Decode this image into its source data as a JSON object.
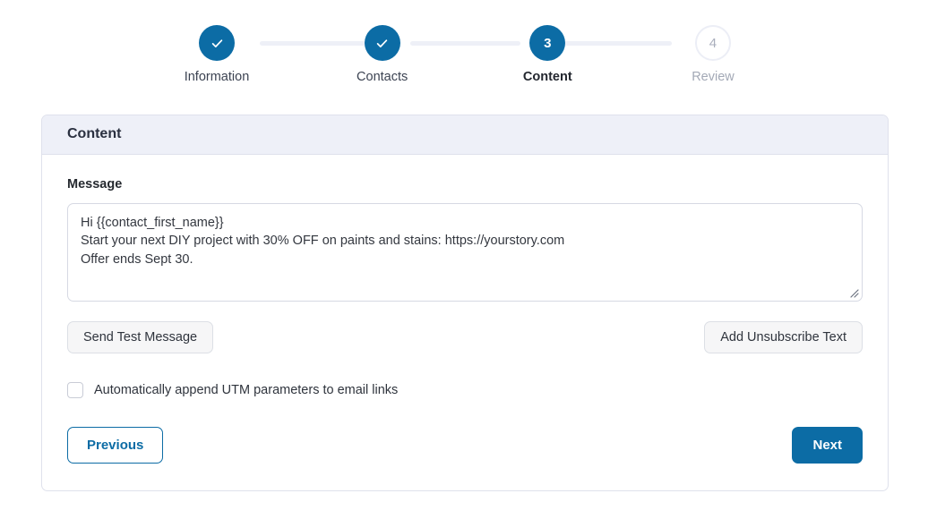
{
  "accent_color": "#0c6ca5",
  "stepper": {
    "steps": [
      {
        "number": "1",
        "label": "Information",
        "state": "complete",
        "icon": "check-icon"
      },
      {
        "number": "2",
        "label": "Contacts",
        "state": "complete",
        "icon": "check-icon"
      },
      {
        "number": "3",
        "label": "Content",
        "state": "current",
        "icon": ""
      },
      {
        "number": "4",
        "label": "Review",
        "state": "pending",
        "icon": ""
      }
    ]
  },
  "card": {
    "title": "Content",
    "message": {
      "label": "Message",
      "value": "Hi {{contact_first_name}}\nStart your next DIY project with 30% OFF on paints and stains: https://yourstory.com\nOffer ends Sept 30.",
      "placeholder": ""
    },
    "actions": {
      "send_test_label": "Send Test Message",
      "add_unsubscribe_label": "Add Unsubscribe Text"
    },
    "utm_option": {
      "label": "Automatically append UTM parameters to email links",
      "checked": false
    },
    "navigation": {
      "previous_label": "Previous",
      "next_label": "Next"
    }
  }
}
